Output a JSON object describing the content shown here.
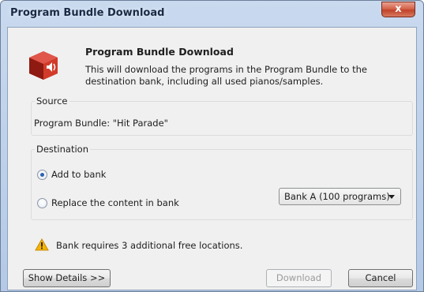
{
  "window": {
    "title": "Program Bundle Download",
    "close_label": "x"
  },
  "header": {
    "heading": "Program Bundle Download",
    "description": "This will download the programs in the Program Bundle to the destination bank, including all used pianos/samples."
  },
  "source": {
    "label": "Source",
    "value": "Program Bundle: \"Hit Parade\""
  },
  "destination": {
    "label": "Destination",
    "options": [
      {
        "label": "Add to bank",
        "checked": true
      },
      {
        "label": "Replace the content in bank",
        "checked": false
      }
    ],
    "bank_select": "Bank A (100 programs)"
  },
  "warning": {
    "text": "Bank requires 3 additional free locations."
  },
  "buttons": {
    "details": "Show Details >>",
    "download": "Download",
    "cancel": "Cancel"
  },
  "colors": {
    "accent_red": "#c0392b",
    "warning_yellow": "#f5b400",
    "radio_dot": "#2b63b4"
  },
  "icons": {
    "app": "speaker-box-icon",
    "warning": "warning-triangle-icon",
    "dropdown": "chevron-down-icon"
  }
}
